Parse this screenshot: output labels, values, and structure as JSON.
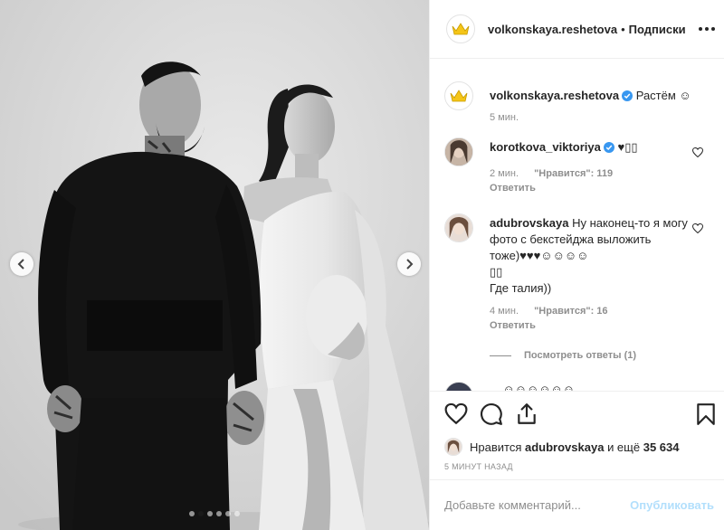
{
  "post": {
    "author": "volkonskaya.reshetova",
    "separator": "•",
    "follow_label": "Подписки",
    "photo": {
      "slide_count": 6,
      "active_slide": 1
    }
  },
  "caption": {
    "username": "volkonskaya.reshetova",
    "verified": true,
    "text": "Растём ☺",
    "time": "5 мин."
  },
  "comments": [
    {
      "username": "korotkova_viktoriya",
      "verified": true,
      "text": "♥▯▯",
      "time": "2 мин.",
      "likes": "\"Нравится\": 119",
      "reply": "Ответить"
    },
    {
      "username": "adubrovskaya",
      "verified": false,
      "text": "Ну наконец-то я могу фото с бекстейджа выложить тоже)♥♥♥☺☺☺☺",
      "text_line2": "▯▯",
      "text_line3": "Где талия))",
      "time": "4 мин.",
      "likes": "\"Нравится\": 16",
      "reply": "Ответить",
      "view_replies": "Посмотреть ответы (1)"
    }
  ],
  "partial_comment": {
    "text": "... ☺☺☺☺☺☺"
  },
  "likes_summary": {
    "prefix": "Нравится",
    "user": "adubrovskaya",
    "middle": "и ещё",
    "count": "35 634"
  },
  "timestamp": "5 МИНУТ НАЗАД",
  "comment_box": {
    "placeholder": "Добавьте комментарий...",
    "publish_label": "Опубликовать"
  },
  "colors": {
    "verified": "#3897f0",
    "publish_disabled": "#b2dffc",
    "muted": "#8e8e8e",
    "crown": "#f5c518"
  },
  "icons": [
    "crown-icon",
    "verified-icon",
    "more-icon",
    "heart-icon",
    "comment-icon",
    "share-icon",
    "bookmark-icon",
    "chevron-left-icon",
    "chevron-right-icon"
  ]
}
